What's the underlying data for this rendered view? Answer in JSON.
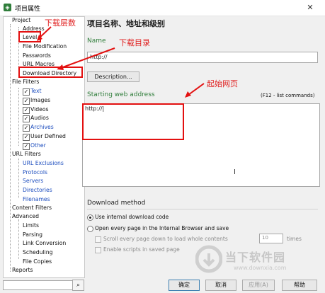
{
  "window": {
    "title": "项目属性",
    "close": "✕"
  },
  "tree": {
    "project": "Project",
    "project_items": [
      "Address",
      "Level",
      "File Modification",
      "Passwords",
      "URL Macros",
      "Download Directory"
    ],
    "file_filters": "File Filters",
    "file_filter_items": [
      "Text",
      "Images",
      "Videos",
      "Audios",
      "Archives",
      "User Defined",
      "Other"
    ],
    "url_filters": "URL Filters",
    "url_filter_items": [
      "URL Exclusions",
      "Protocols",
      "Servers",
      "Directories",
      "Filenames"
    ],
    "content_filters": "Content Filters",
    "advanced": "Advanced",
    "advanced_items": [
      "Limits",
      "Parsing",
      "Link Conversion",
      "Scheduling",
      "File Copies"
    ],
    "reports": "Reports"
  },
  "main": {
    "heading": "项目名称、地址和级别",
    "name_label": "Name",
    "name_value": "http://",
    "description_button": "Description...",
    "start_label": "Starting web address",
    "start_hint": "(F12 - list commands)",
    "start_value": "http://",
    "download_method": "Download method",
    "opt1": "Use internal download code",
    "opt2": "Open every page in the Internal Browser and save",
    "sub1": "Scroll every page down to load whole contents",
    "sub1_value": "10",
    "sub1_unit": "times",
    "sub2": "Enable scripts in saved page"
  },
  "buttons": {
    "ok": "确定",
    "cancel": "取消",
    "apply": "应用(A)",
    "help": "帮助"
  },
  "annotations": {
    "level": "下载层数",
    "dir": "下载目录",
    "start": "起始网页"
  },
  "watermark": {
    "brand": "当下软件园",
    "url": "www.downxia.com"
  },
  "colors": {
    "accent_green": "#2f7d3a",
    "link_blue": "#1f4fbf",
    "annotation_red": "#e31010"
  }
}
